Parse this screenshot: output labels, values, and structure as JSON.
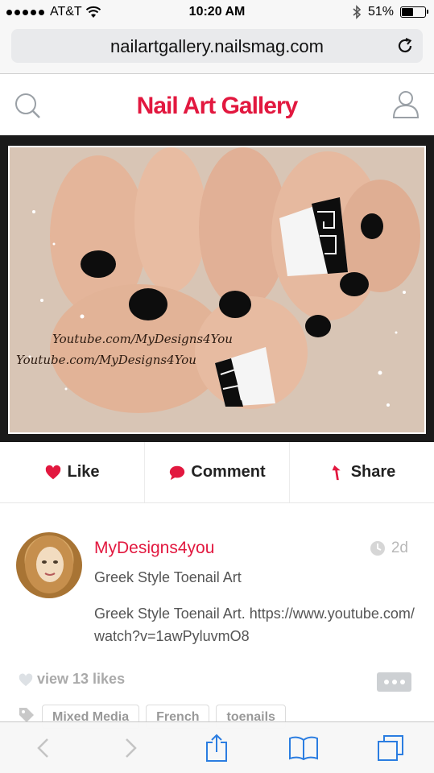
{
  "status_bar": {
    "carrier": "AT&T",
    "time": "10:20 AM",
    "battery": "51%",
    "battery_level": 0.51
  },
  "browser": {
    "url": "nailartgallery.nailsmag.com"
  },
  "site": {
    "logo": "Nail Art Gallery"
  },
  "hero": {
    "watermark_1": "Youtube.com/MyDesigns4You",
    "watermark_2": "Youtube.com/MyDesigns4You"
  },
  "actions": {
    "like": "Like",
    "comment": "Comment",
    "share": "Share"
  },
  "post": {
    "author": "MyDesigns4you",
    "age": "2d",
    "title": "Greek Style Toenail Art",
    "description": "Greek Style Toenail Art. https://www.youtube.com/watch?v=1awPyluvmO8",
    "likes": "view 13 likes",
    "tags": [
      "Mixed Media",
      "French",
      "toenails"
    ]
  },
  "colors": {
    "brand": "#e2183f",
    "ios_blue": "#2b7de1"
  }
}
